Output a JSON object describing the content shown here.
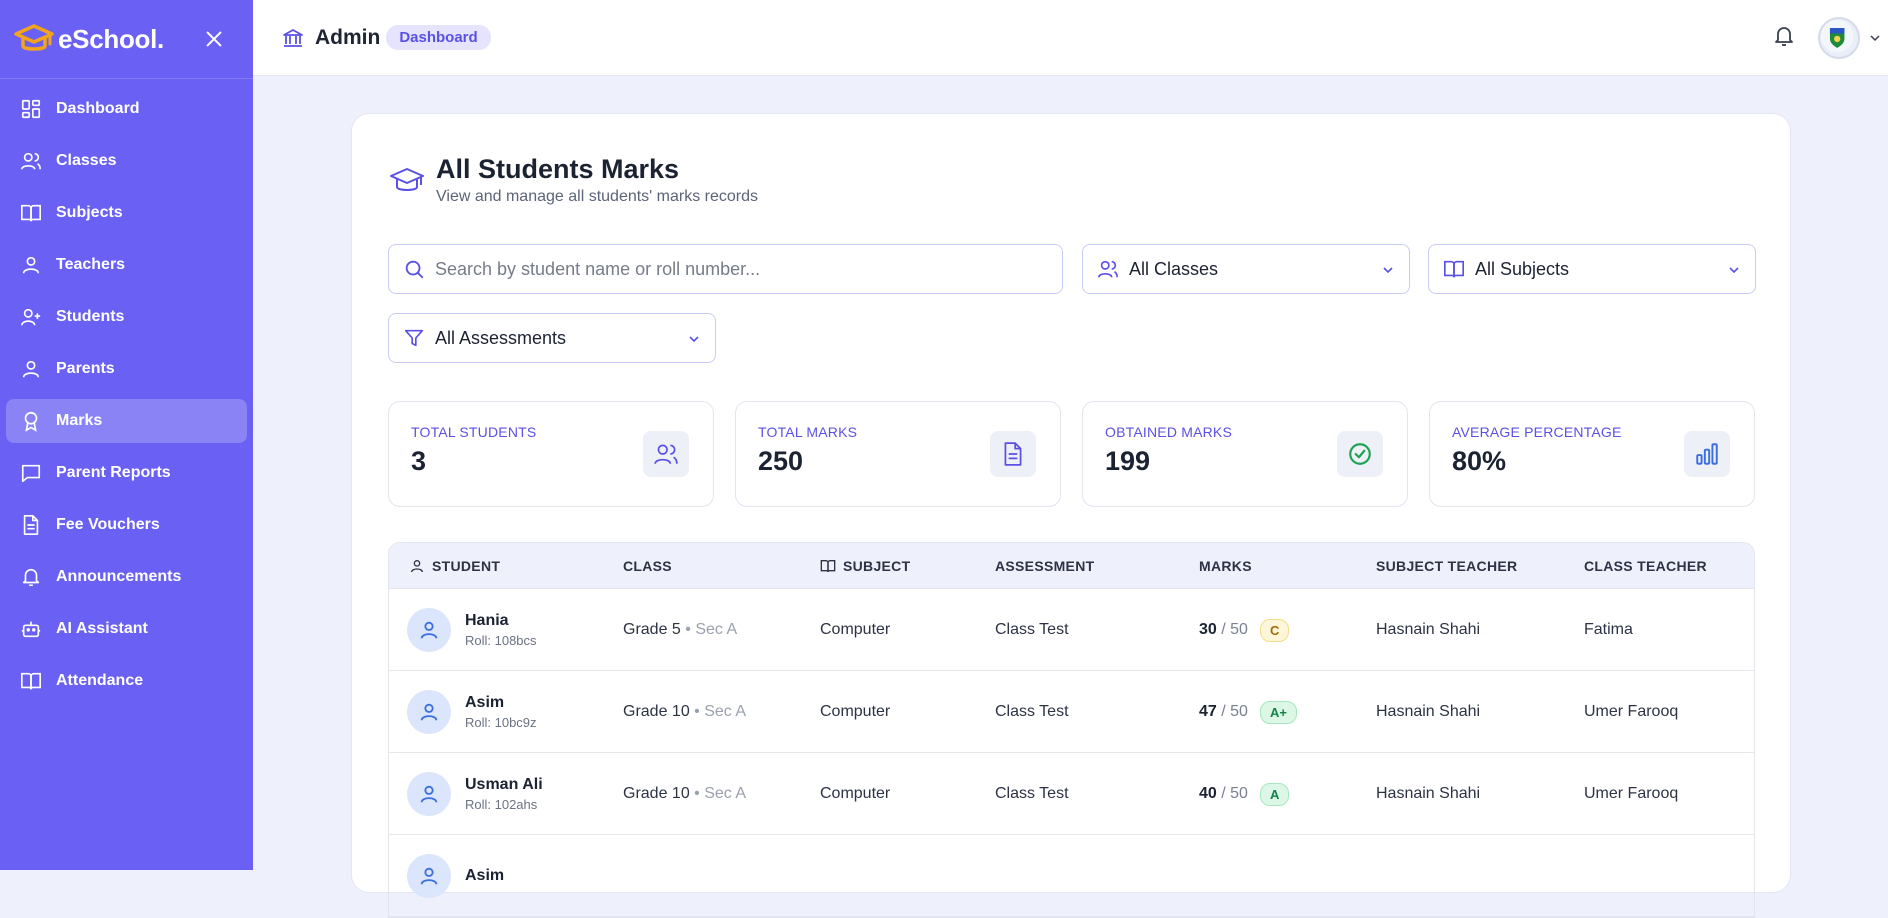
{
  "brand": {
    "name": "eSchool."
  },
  "sidebar": {
    "items": [
      {
        "label": "Dashboard",
        "icon": "dashboard-icon",
        "active": false
      },
      {
        "label": "Classes",
        "icon": "users-icon",
        "active": false
      },
      {
        "label": "Subjects",
        "icon": "book-icon",
        "active": false
      },
      {
        "label": "Teachers",
        "icon": "user-icon",
        "active": false
      },
      {
        "label": "Students",
        "icon": "user-plus-icon",
        "active": false
      },
      {
        "label": "Parents",
        "icon": "user-icon",
        "active": false
      },
      {
        "label": "Marks",
        "icon": "award-icon",
        "active": true
      },
      {
        "label": "Parent Reports",
        "icon": "message-square-icon",
        "active": false
      },
      {
        "label": "Fee Vouchers",
        "icon": "file-text-icon",
        "active": false
      },
      {
        "label": "Announcements",
        "icon": "bell-icon",
        "active": false
      },
      {
        "label": "AI Assistant",
        "icon": "bot-icon",
        "active": false
      },
      {
        "label": "Attendance",
        "icon": "book-open-icon",
        "active": false
      }
    ]
  },
  "topbar": {
    "title": "Admin",
    "breadcrumb": "Dashboard"
  },
  "page": {
    "title": "All Students Marks",
    "subtitle": "View and manage all students' marks records"
  },
  "filters": {
    "search_placeholder": "Search by student name or roll number...",
    "class_value": "All Classes",
    "subject_value": "All Subjects",
    "assessment_value": "All Assessments"
  },
  "stats": [
    {
      "label": "Total Students",
      "value": "3",
      "icon": "users-icon"
    },
    {
      "label": "Total Marks",
      "value": "250",
      "icon": "file-text-icon"
    },
    {
      "label": "Obtained Marks",
      "value": "199",
      "icon": "check-circle-icon"
    },
    {
      "label": "Average Percentage",
      "value": "80%",
      "icon": "bar-chart-icon"
    }
  ],
  "table": {
    "columns": [
      "STUDENT",
      "CLASS",
      "SUBJECT",
      "ASSESSMENT",
      "MARKS",
      "SUBJECT TEACHER",
      "CLASS TEACHER"
    ],
    "rows": [
      {
        "name": "Hania",
        "roll": "Roll: 108bcs",
        "grade_class": "Grade 5",
        "section": "• Sec A",
        "subject": "Computer",
        "assessment": "Class Test",
        "obtained": "30",
        "total": "/ 50",
        "grade": "C",
        "subject_teacher": "Hasnain Shahi",
        "class_teacher": "Fatima"
      },
      {
        "name": "Asim",
        "roll": "Roll: 10bc9z",
        "grade_class": "Grade 10",
        "section": "• Sec A",
        "subject": "Computer",
        "assessment": "Class Test",
        "obtained": "47",
        "total": "/ 50",
        "grade": "A+",
        "subject_teacher": "Hasnain Shahi",
        "class_teacher": "Umer Farooq"
      },
      {
        "name": "Usman Ali",
        "roll": "Roll: 102ahs",
        "grade_class": "Grade 10",
        "section": "• Sec A",
        "subject": "Computer",
        "assessment": "Class Test",
        "obtained": "40",
        "total": "/ 50",
        "grade": "A",
        "subject_teacher": "Hasnain Shahi",
        "class_teacher": "Umer Farooq"
      },
      {
        "name": "Asim",
        "roll": "",
        "grade_class": "",
        "section": "",
        "subject": "",
        "assessment": "",
        "obtained": "",
        "total": "",
        "grade": "",
        "subject_teacher": "",
        "class_teacher": ""
      }
    ]
  },
  "colors": {
    "sidebar": "#6a60f4",
    "accent": "#5a50e6",
    "grade_c_bg": "#fdf6d8",
    "grade_c_fg": "#a36a07",
    "grade_a_bg": "#dcf7e5",
    "grade_a_fg": "#14834a"
  }
}
